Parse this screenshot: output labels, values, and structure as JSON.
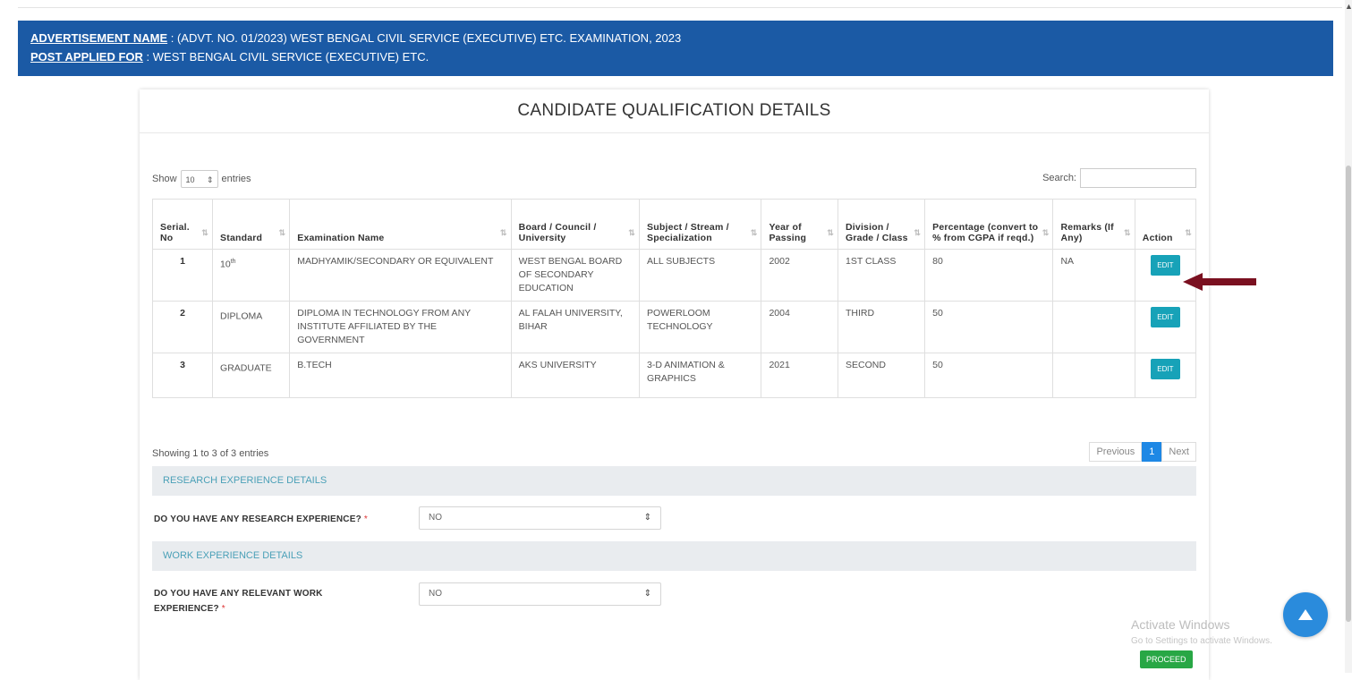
{
  "banner": {
    "adv_label": "ADVERTISEMENT NAME",
    "adv_value": " : (ADVT. NO. 01/2023) WEST BENGAL CIVIL SERVICE (EXECUTIVE) ETC. EXAMINATION, 2023",
    "post_label": "POST APPLIED FOR",
    "post_value": " : WEST BENGAL CIVIL SERVICE (EXECUTIVE) ETC."
  },
  "card": {
    "title": "CANDIDATE QUALIFICATION DETAILS"
  },
  "datatable": {
    "show_label": "Show",
    "entries_value": "10",
    "entries_label": "entries",
    "search_label": "Search:",
    "info": "Showing 1 to 3 of 3 entries",
    "prev_label": "Previous",
    "page": "1",
    "next_label": "Next"
  },
  "table": {
    "headers": [
      "Serial. No",
      "Standard",
      "Examination Name",
      "Board / Council / University",
      "Subject / Stream / Specialization",
      "Year of Passing",
      "Division / Grade / Class",
      "Percentage (convert to % from CGPA if reqd.)",
      "Remarks (If Any)",
      "Action"
    ],
    "rows": [
      {
        "serial": "1",
        "standard": "10",
        "standard_sup": "th",
        "exam": "MADHYAMIK/SECONDARY OR EQUIVALENT",
        "board": "WEST BENGAL BOARD OF SECONDARY EDUCATION",
        "subject": "ALL SUBJECTS",
        "year": "2002",
        "division": "1ST CLASS",
        "percentage": "80",
        "remarks": "NA",
        "action": "EDIT"
      },
      {
        "serial": "2",
        "standard": "DIPLOMA",
        "standard_sup": "",
        "exam": "DIPLOMA IN TECHNOLOGY FROM ANY INSTITUTE AFFILIATED BY THE GOVERNMENT",
        "board": "AL FALAH UNIVERSITY, BIHAR",
        "subject": "POWERLOOM TECHNOLOGY",
        "year": "2004",
        "division": "THIRD",
        "percentage": "50",
        "remarks": "",
        "action": "EDIT"
      },
      {
        "serial": "3",
        "standard": "GRADUATE",
        "standard_sup": "",
        "exam": "B.TECH",
        "board": "AKS UNIVERSITY",
        "subject": "3-D ANIMATION & GRAPHICS",
        "year": "2021",
        "division": "SECOND",
        "percentage": "50",
        "remarks": "",
        "action": "EDIT"
      }
    ]
  },
  "research": {
    "section_title": "RESEARCH EXPERIENCE DETAILS",
    "question": "DO YOU HAVE ANY RESEARCH EXPERIENCE?",
    "required": "*",
    "value": "NO"
  },
  "work": {
    "section_title": "WORK EXPERIENCE DETAILS",
    "question_line1": "DO YOU HAVE ANY RELEVANT WORK",
    "question_line2": "EXPERIENCE?",
    "required": "*",
    "value": "NO"
  },
  "proceed_label": "PROCEED",
  "watermark": {
    "line1": "Activate Windows",
    "line2": "Go to Settings to activate Windows."
  },
  "colors": {
    "banner": "#1b5aa5",
    "edit_button": "#17a2b8",
    "proceed_button": "#28a745",
    "arrow": "#7a1020",
    "fab": "#2a8bdc"
  },
  "icons": [
    "sort-icon",
    "select-arrow-icon",
    "red-arrow-icon",
    "scroll-top-icon"
  ]
}
